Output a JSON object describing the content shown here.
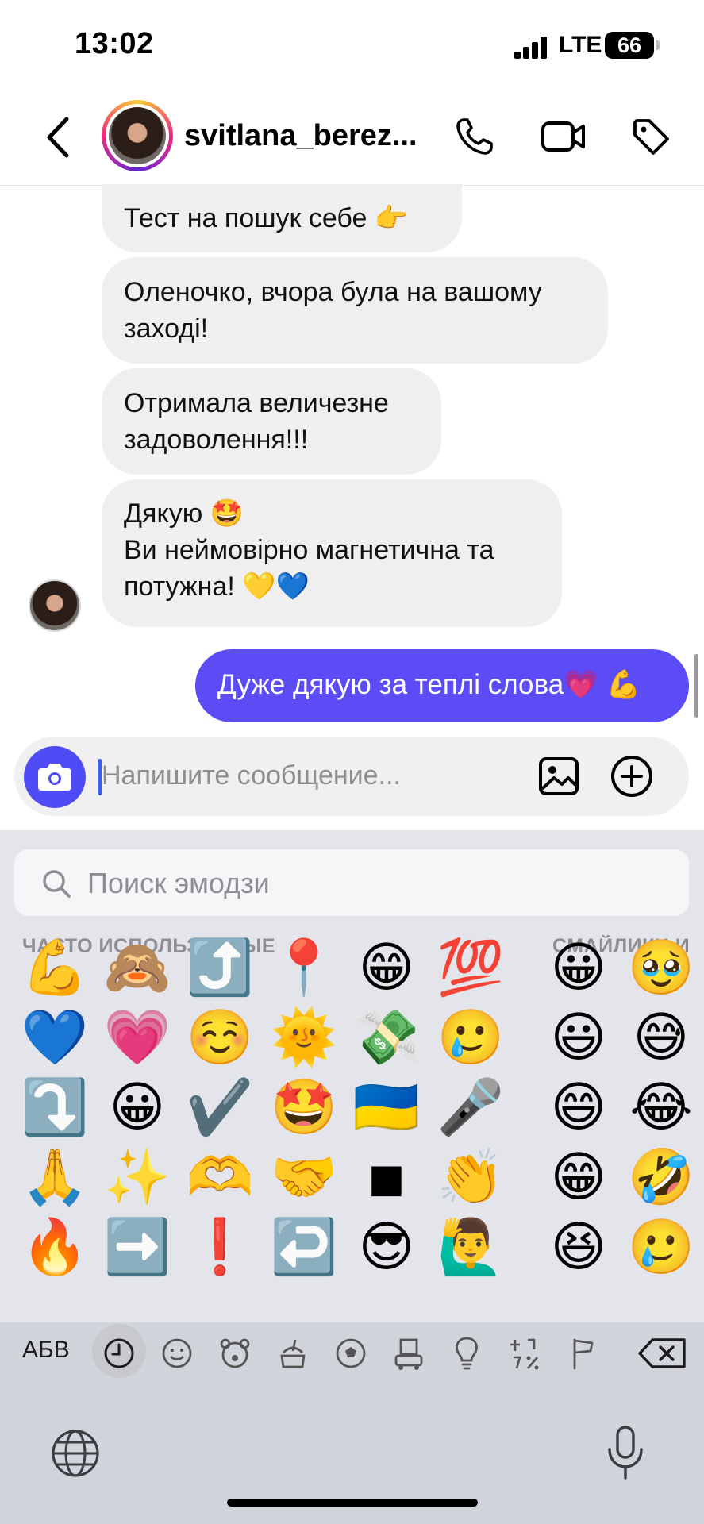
{
  "status_bar": {
    "time": "13:02",
    "network": "LTE",
    "battery": "66"
  },
  "header": {
    "username": "svitlana_berez..."
  },
  "messages": {
    "m1": "Тест на пошук себе 👉",
    "m2_l1": "Оленочко, вчора була на вашому",
    "m2_l2": "заході!",
    "m3_l1": "Отримала величезне",
    "m3_l2": "задоволення!!!",
    "m4_l1": "Дякую 🤩",
    "m4_l2": "Ви неймовірно магнетична та",
    "m4_l3": "потужна! 💛💙",
    "out1": "Дуже дякую за теплі слова💗 💪"
  },
  "composer": {
    "placeholder": "Напишите сообщение..."
  },
  "keyboard": {
    "search_placeholder": "Поиск эмодзи",
    "section_frequent": "ЧАСТО ИСПОЛЬЗУЕМЫЕ",
    "section_smileys": "СМАЙЛИКИ И",
    "abc_label": "АБВ",
    "frequent": [
      [
        "💪",
        "🙈",
        "⤴️",
        "📍",
        "😁",
        "💯"
      ],
      [
        "💙",
        "💗",
        "☺️",
        "🌞",
        "💸",
        "🥲"
      ],
      [
        "⤵️",
        "😀",
        "✔️",
        "🤩",
        "🇺🇦",
        "🎤"
      ],
      [
        "🙏",
        "✨",
        "🫶",
        "🤝",
        "◾",
        "👏"
      ],
      [
        "🔥",
        "➡️",
        "❗",
        "↩️",
        "😎",
        "🙋‍♂️"
      ]
    ],
    "smileys": [
      [
        "😀",
        "🥹"
      ],
      [
        "😃",
        "😅"
      ],
      [
        "😄",
        "😂"
      ],
      [
        "😁",
        "🤣"
      ],
      [
        "😆",
        "🥲"
      ]
    ]
  }
}
